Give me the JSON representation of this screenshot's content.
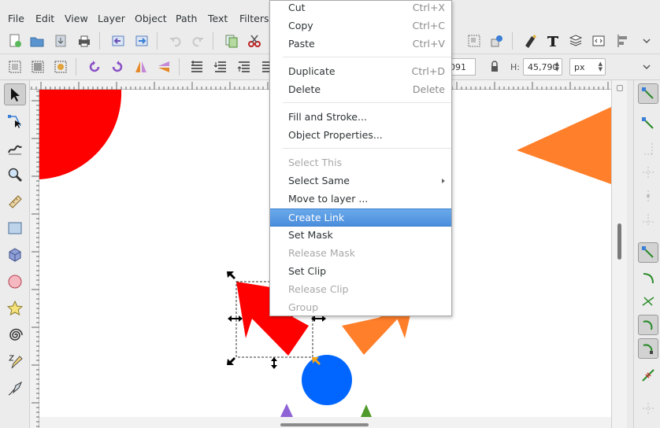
{
  "menubar": {
    "items": [
      "File",
      "Edit",
      "View",
      "Layer",
      "Object",
      "Path",
      "Text",
      "Filters"
    ]
  },
  "controls": {
    "w_value_partial": "091",
    "h_label": "H:",
    "h_value": "45,790",
    "unit": "px"
  },
  "context_menu": {
    "items": [
      {
        "label": "Cut",
        "accel": "Ctrl+X"
      },
      {
        "label": "Copy",
        "accel": "Ctrl+C"
      },
      {
        "label": "Paste",
        "accel": "Ctrl+V"
      },
      {
        "label": "Duplicate",
        "accel": "Ctrl+D"
      },
      {
        "label": "Delete",
        "accel": "Delete"
      },
      {
        "label": "Fill and Stroke..."
      },
      {
        "label": "Object Properties..."
      },
      {
        "label": "Select This"
      },
      {
        "label": "Select Same"
      },
      {
        "label": "Move to layer ..."
      },
      {
        "label": "Create Link"
      },
      {
        "label": "Set Mask"
      },
      {
        "label": "Release Mask"
      },
      {
        "label": "Set Clip"
      },
      {
        "label": "Release Clip"
      },
      {
        "label": "Group"
      }
    ]
  },
  "colors": {
    "red_shape": "#ff0000",
    "orange_shape": "#ff7f2a",
    "blue_circle": "#0066ff",
    "purple_shape": "#8e63d6",
    "green_shape": "#4f9a2a",
    "highlight": "#4a8ddc"
  }
}
